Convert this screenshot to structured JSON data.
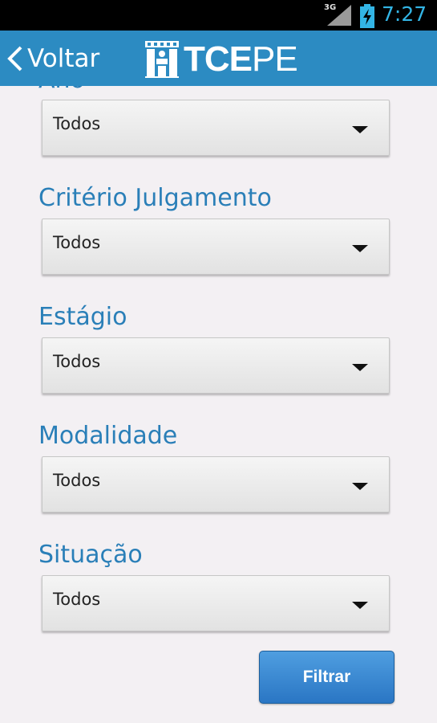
{
  "status_bar": {
    "network": "3G",
    "time": "7:27",
    "icons": [
      "signal-icon",
      "battery-charging-icon"
    ]
  },
  "app_bar": {
    "back_label": "Voltar",
    "logo_text_bold": "TCE",
    "logo_text_thin": "PE"
  },
  "filters": [
    {
      "label": "Ano",
      "value": "Todos"
    },
    {
      "label": "Critério Julgamento",
      "value": "Todos"
    },
    {
      "label": "Estágio",
      "value": "Todos"
    },
    {
      "label": "Modalidade",
      "value": "Todos"
    },
    {
      "label": "Situação",
      "value": "Todos"
    }
  ],
  "filter_button": {
    "label": "Filtrar"
  },
  "colors": {
    "app_bar": "#2c8bc2",
    "label": "#2a7fb8",
    "status_accent": "#33b5e5",
    "button": "#2a76c4",
    "background": "#f3f0f3"
  }
}
